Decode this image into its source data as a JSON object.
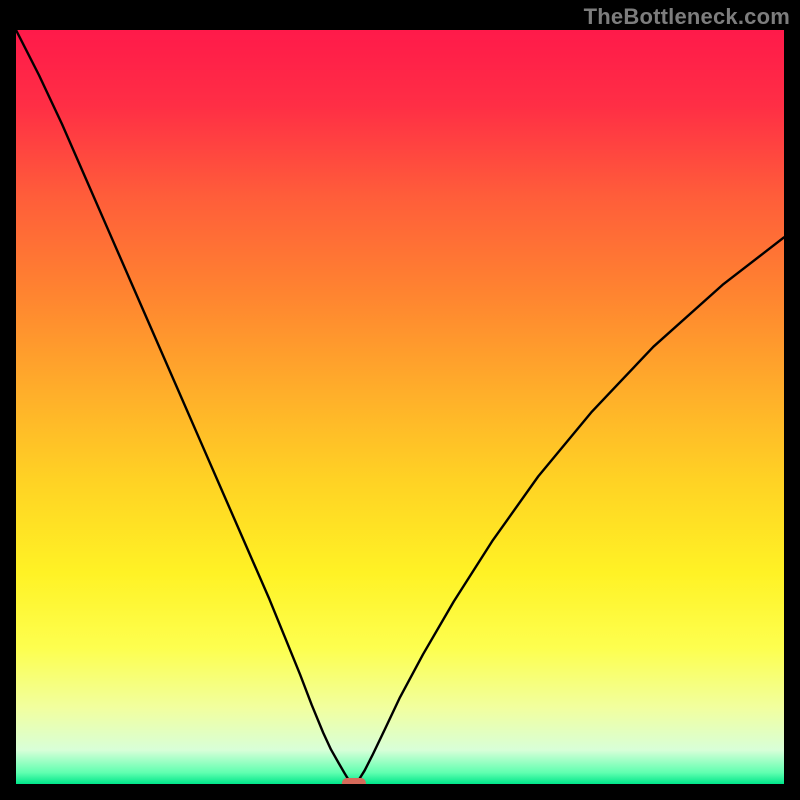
{
  "watermark": "TheBottleneck.com",
  "colors": {
    "frame": "#000000",
    "curve": "#000000",
    "marker": "#d66a5a",
    "gradient_stops": [
      {
        "offset": 0.0,
        "color": "#ff1a4a"
      },
      {
        "offset": 0.1,
        "color": "#ff2e45"
      },
      {
        "offset": 0.22,
        "color": "#ff5d3a"
      },
      {
        "offset": 0.35,
        "color": "#ff8430"
      },
      {
        "offset": 0.48,
        "color": "#ffae2a"
      },
      {
        "offset": 0.6,
        "color": "#ffd324"
      },
      {
        "offset": 0.72,
        "color": "#fff225"
      },
      {
        "offset": 0.82,
        "color": "#fdff4f"
      },
      {
        "offset": 0.9,
        "color": "#f1ffa0"
      },
      {
        "offset": 0.955,
        "color": "#d8ffd8"
      },
      {
        "offset": 0.985,
        "color": "#60ffb0"
      },
      {
        "offset": 1.0,
        "color": "#00e68a"
      }
    ]
  },
  "chart_data": {
    "type": "line",
    "title": "",
    "xlabel": "",
    "ylabel": "",
    "xlim": [
      0,
      100
    ],
    "ylim": [
      0,
      100
    ],
    "x": [
      0,
      3,
      6,
      9,
      12,
      15,
      18,
      21,
      24,
      27,
      30,
      33,
      35,
      37,
      38.5,
      40,
      41,
      42,
      42.8,
      43.4,
      44,
      44.6,
      45.4,
      46.4,
      48,
      50,
      53,
      57,
      62,
      68,
      75,
      83,
      92,
      100
    ],
    "y": [
      100,
      94,
      87.5,
      80.5,
      73.5,
      66.5,
      59.5,
      52.5,
      45.5,
      38.5,
      31.5,
      24.5,
      19.5,
      14.5,
      10.5,
      6.8,
      4.6,
      2.8,
      1.4,
      0.4,
      0,
      0.5,
      1.8,
      3.8,
      7.2,
      11.5,
      17.2,
      24.2,
      32.2,
      40.8,
      49.4,
      58.0,
      66.2,
      72.5
    ],
    "marker": {
      "x": 44,
      "y": 0
    },
    "notes": "V-shaped bottleneck curve over vertical red→green gradient. Values read approximately from pixel positions; y expressed as percent of plot height from bottom, x as percent of plot width from left."
  }
}
